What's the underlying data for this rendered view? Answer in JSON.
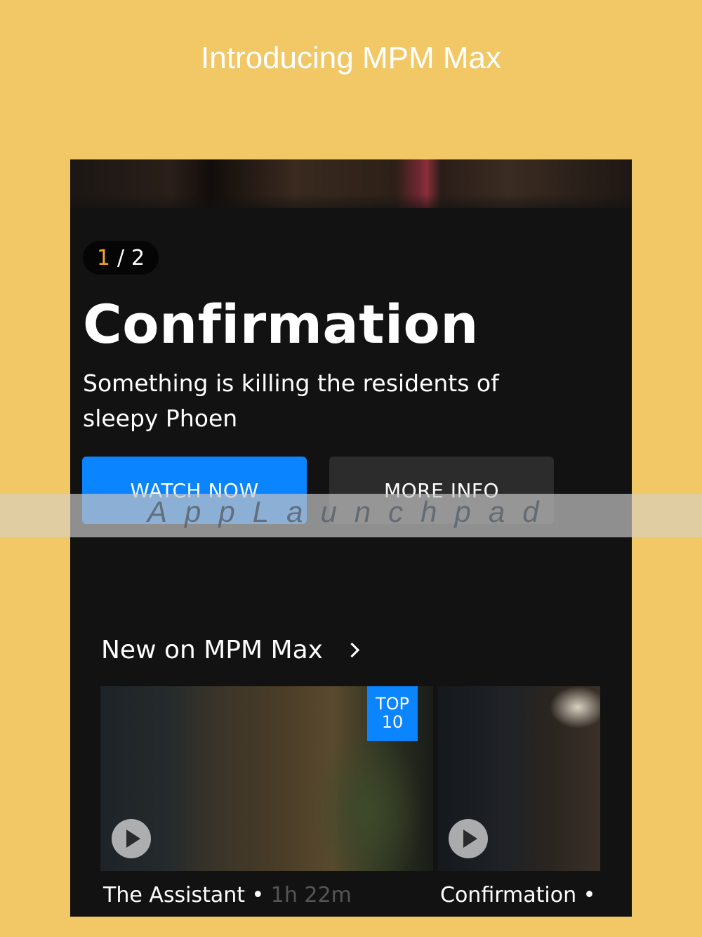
{
  "promo": {
    "title": "Introducing MPM Max"
  },
  "hero": {
    "page_current": "1",
    "page_separator": "/",
    "page_total": "2",
    "title": "Confirmation",
    "description": "Something is killing the residents of sleepy Phoen",
    "watch_label": "WATCH NOW",
    "more_label": "MORE INFO"
  },
  "section": {
    "title": "New on MPM Max"
  },
  "rail": [
    {
      "title": "The Assistant",
      "sep": " • ",
      "duration": "1h 22m",
      "badge_line1": "TOP",
      "badge_line2": "10"
    },
    {
      "title": "Confirmation",
      "sep": " • "
    }
  ],
  "watermark": {
    "text": "AppLaunchpad"
  },
  "colors": {
    "background": "#f2c867",
    "app_bg": "#121212",
    "accent_blue": "#0a84ff",
    "accent_orange": "#f5a623",
    "secondary_button": "#2c2c2c"
  },
  "icons": {
    "play": "play-icon",
    "chevron": "chevron-right-icon"
  }
}
